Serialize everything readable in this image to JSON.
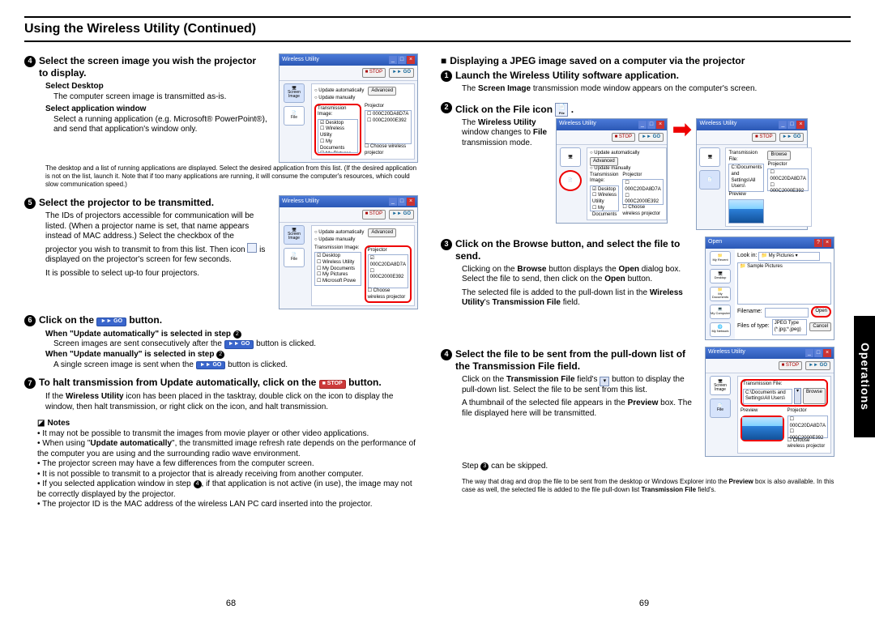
{
  "page_title": "Using the Wireless Utility (Continued)",
  "side_tab": "Operations",
  "page_left_num": "68",
  "page_right_num": "69",
  "left": {
    "step4_head": "Select the screen image you wish the projector to display.",
    "step4_a": "Select Desktop",
    "step4_a_body": "The computer screen image is transmitted as-is.",
    "step4_b": "Select application window",
    "step4_b_body": "Select a running application (e.g. Microsoft® PowerPoint®), and send that application's window only.",
    "step4_fine": "The desktop and a list of running applications are displayed. Select the desired application from this list. (If the desired application is not on the list, launch it. Note that if too many applications are running, it will consume the computer's resources, which could slow communication speed.)",
    "step5_head": "Select the projector to be transmitted.",
    "step5_body1": "The IDs of projectors accessible for communication will be listed. (When a projector name is set, that name appears instead of MAC address.) Select the checkbox of the projector you wish to transmit to from this list. Then icon",
    "step5_body1b": "is displayed on the projector's screen for few seconds.",
    "step5_body2": "It is possible to select up-to four projectors.",
    "step6_head_pre": "Click on the ",
    "step6_head_post": " button.",
    "step6_a": "When \"Update automatically\" is selected in step ",
    "step6_a_body_pre": "Screen images are sent consecutively after the ",
    "step6_a_body_post": " button is clicked.",
    "step6_b": "When \"Update manually\" is selected in step ",
    "step6_b_body_pre": "A single screen image is sent when the ",
    "step6_b_body_post": " button is clicked.",
    "step7_head_pre": "To halt transmission from Update automatically, click on the ",
    "step7_head_post": " button.",
    "step7_body": "If the Wireless Utility icon has been placed in the tasktray, double click on the icon to display the window, then halt transmission, or right click on the icon, and halt transmission.",
    "notes_label": "Notes",
    "notes": [
      "It may not be possible to transmit the images from movie player or other video applications.",
      "When using \"Update automatically\", the transmitted image refresh rate depends on the performance of the computer you are using and the surrounding radio wave environment.",
      "The projector screen may have a few differences from the computer screen.",
      "It is not possible to transmit to a projector that is already receiving from another computer.",
      "If you selected application window in step 4, if that application is not active (in use), the image may not be correctly displayed by the projector.",
      "The projector ID is the MAC address of the wireless LAN PC card inserted into the projector."
    ]
  },
  "right": {
    "section_head": "Displaying a JPEG image saved on a computer via the projector",
    "step1_head": "Launch the Wireless Utility software application.",
    "step1_body": "The Screen Image transmission mode window appears on the computer's screen.",
    "step2_head_pre": "Click on the File icon ",
    "step2_head_post": ".",
    "step2_body_pre": "The ",
    "step2_body_bold": "Wireless Utility",
    "step2_body_mid": " window changes to ",
    "step2_body_bold2": "File",
    "step2_body_post": " transmission mode.",
    "step3_head": "Click on the Browse button, and select the file to send.",
    "step3_body1_pre": "Clicking on the ",
    "step3_body1_b1": "Browse",
    "step3_body1_mid": " button displays the ",
    "step3_body1_b2": "Open",
    "step3_body1_mid2": " dialog box. Select the file to send, then click on the ",
    "step3_body1_b3": "Open",
    "step3_body1_post": " button.",
    "step3_body2_pre": "The selected file is added to the pull-down list in the ",
    "step3_body2_b1": "Wireless Utility",
    "step3_body2_mid": "'s ",
    "step3_body2_b2": "Transmission File",
    "step3_body2_post": " field.",
    "step4_head": "Select the file to be sent from the pull-down list of the Transmission File field.",
    "step4_body1_pre": "Click on the ",
    "step4_body1_b1": "Transmission File",
    "step4_body1_mid": " field's ",
    "step4_body1_post": " button to display the pull-down list. Select the file to be sent from this list.",
    "step4_body2_pre": "A thumbnail of the selected file appears in the ",
    "step4_body2_b1": "Preview",
    "step4_body2_post": " box. The file displayed here will be transmitted.",
    "step4_skip_pre": "Step ",
    "step4_skip_post": " can be skipped.",
    "step4_fine_pre": "The way that drag and drop the file to be sent from the desktop or Windows Explorer into the ",
    "step4_fine_b1": "Preview",
    "step4_fine_mid": " box is also available. In this case as well, the selected file is added to the file pull-down list ",
    "step4_fine_b2": "Transmission File",
    "step4_fine_post": " field's."
  },
  "shot": {
    "title": "Wireless Utility",
    "stop": "■ STOP",
    "go": "►► GO",
    "adv": "Advanced",
    "icon_screen": "Screen Image",
    "icon_file": "File",
    "update_auto": "Update automatically",
    "update_man": "Update manually",
    "trans_image": "Transmission Image:",
    "proj": "Projector",
    "list1": "Desktop",
    "list2": "Wireless Utility",
    "list3": "My Documents",
    "list4": "My Pictures",
    "list5": "Microsoft Powe",
    "proj1": "000C20DA8D7A",
    "proj2": "000C2000E392",
    "choose": "Choose wireless projector",
    "trans_file": "Transmission File:",
    "path": "C:\\Documents and Settings\\All Users\\",
    "browse": "Browse",
    "preview": "Preview",
    "open_title": "Open",
    "lookin": "Look in:",
    "mypics": "My Pictures",
    "samplepics": "Sample Pictures",
    "filename": "Filename:",
    "filetype": "Files of type:",
    "jpegtype": "JPEG Type (*.jpg;*.jpeg)",
    "open_btn": "Open",
    "cancel_btn": "Cancel",
    "myrecent": "My Recent",
    "desktop_side": "Desktop",
    "mydocs_side": "My Documents",
    "mycomp": "My Computer",
    "mynet": "My Network"
  }
}
